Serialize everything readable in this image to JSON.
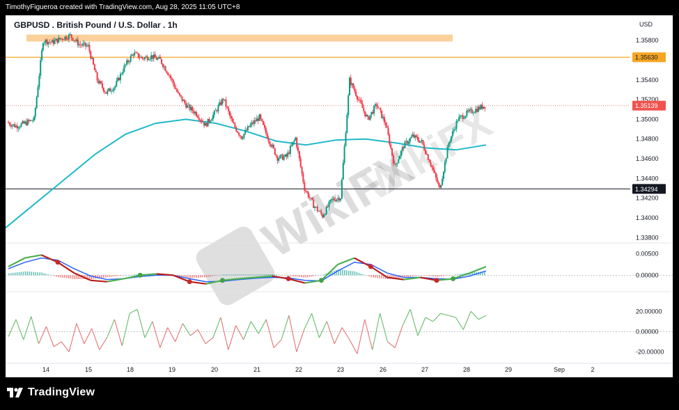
{
  "header": {
    "attribution": "TimothyFigueroa created with TradingView.com, Aug 28, 2025 11:05 UTC+8"
  },
  "chart_data": {
    "type": "candlestick",
    "title": "GBPUSD . British Pound / U.S. Dollar . 1h",
    "currency": "USD",
    "y_ticks": [
      "1.35800",
      "1.35400",
      "1.35200",
      "1.35000",
      "1.34800",
      "1.34600",
      "1.34400",
      "1.34200",
      "1.34000",
      "1.33800"
    ],
    "ylim": [
      1.3376,
      1.359
    ],
    "x_ticks": [
      "14",
      "15",
      "18",
      "19",
      "20",
      "21",
      "22",
      "23",
      "26",
      "27",
      "28",
      "29",
      "Sep",
      "2"
    ],
    "price_labels": {
      "resistance": "1.35630",
      "current": "1.35139",
      "support": "1.34294"
    },
    "resistance_level": 1.3563,
    "support_level": 1.34294,
    "current_price": 1.35139,
    "supply_zone": [
      1.3579,
      1.3586
    ],
    "price_path": [
      1.3497,
      1.3493,
      1.3496,
      1.35,
      1.358,
      1.3578,
      1.3582,
      1.3585,
      1.3576,
      1.3574,
      1.354,
      1.3527,
      1.3534,
      1.3553,
      1.3567,
      1.3562,
      1.3564,
      1.356,
      1.3545,
      1.3525,
      1.3513,
      1.3506,
      1.3494,
      1.3506,
      1.3521,
      1.3496,
      1.3482,
      1.3494,
      1.3502,
      1.348,
      1.3461,
      1.3462,
      1.3481,
      1.343,
      1.3413,
      1.3402,
      1.3418,
      1.3421,
      1.354,
      1.352,
      1.35,
      1.3515,
      1.3495,
      1.3452,
      1.3473,
      1.3483,
      1.3477,
      1.3455,
      1.3429,
      1.3476,
      1.35,
      1.3506,
      1.351,
      1.3514
    ],
    "ma_path": [
      1.339,
      1.3415,
      1.344,
      1.3465,
      1.3485,
      1.3496,
      1.35,
      1.3496,
      1.3488,
      1.3478,
      1.3474,
      1.3479,
      1.348,
      1.3476,
      1.3471,
      1.3469,
      1.3474
    ],
    "macd": {
      "y_ticks": [
        "0.00500",
        "0.00000"
      ],
      "ylim": [
        -0.003,
        0.007
      ],
      "macd_line": [
        0.002,
        0.004,
        0.0047,
        0.003,
        0.0005,
        -0.0012,
        -0.0015,
        -0.0008,
        0.0,
        0.0003,
        0.0,
        -0.0015,
        -0.002,
        -0.0012,
        -0.0008,
        -0.0005,
        -0.0002,
        -0.0008,
        -0.0018,
        -0.0012,
        0.0025,
        0.004,
        0.002,
        -0.0005,
        -0.001,
        -0.0005,
        -0.0012,
        -0.0008,
        0.0005,
        0.002
      ],
      "signal_line": [
        0.0015,
        0.003,
        0.004,
        0.0035,
        0.0015,
        -0.0002,
        -0.001,
        -0.0008,
        -0.0003,
        0.0,
        0.0,
        -0.0008,
        -0.0015,
        -0.0014,
        -0.001,
        -0.0007,
        -0.0005,
        -0.0006,
        -0.0012,
        -0.0013,
        0.001,
        0.003,
        0.0025,
        0.0005,
        -0.0005,
        -0.0005,
        -0.0008,
        -0.0009,
        -0.0002,
        0.001
      ]
    },
    "oscillator": {
      "y_ticks": [
        "20.00000",
        "0.00000",
        "-20.00000"
      ],
      "ylim": [
        -28,
        34
      ],
      "values": [
        -5,
        12,
        -8,
        15,
        -12,
        5,
        -15,
        -10,
        -20,
        8,
        -12,
        3,
        -18,
        -6,
        12,
        -14,
        18,
        22,
        -6,
        10,
        -16,
        4,
        -10,
        8,
        -4,
        2,
        -12,
        -6,
        14,
        -18,
        6,
        -8,
        10,
        -2,
        12,
        -16,
        -8,
        16,
        -20,
        2,
        18,
        -6,
        10,
        -12,
        4,
        -8,
        -22,
        12,
        -18,
        18,
        -10,
        -16,
        6,
        22,
        -4,
        14,
        10,
        18,
        16,
        14,
        2,
        20,
        12,
        16
      ]
    },
    "watermark": "WikiFX"
  }
}
